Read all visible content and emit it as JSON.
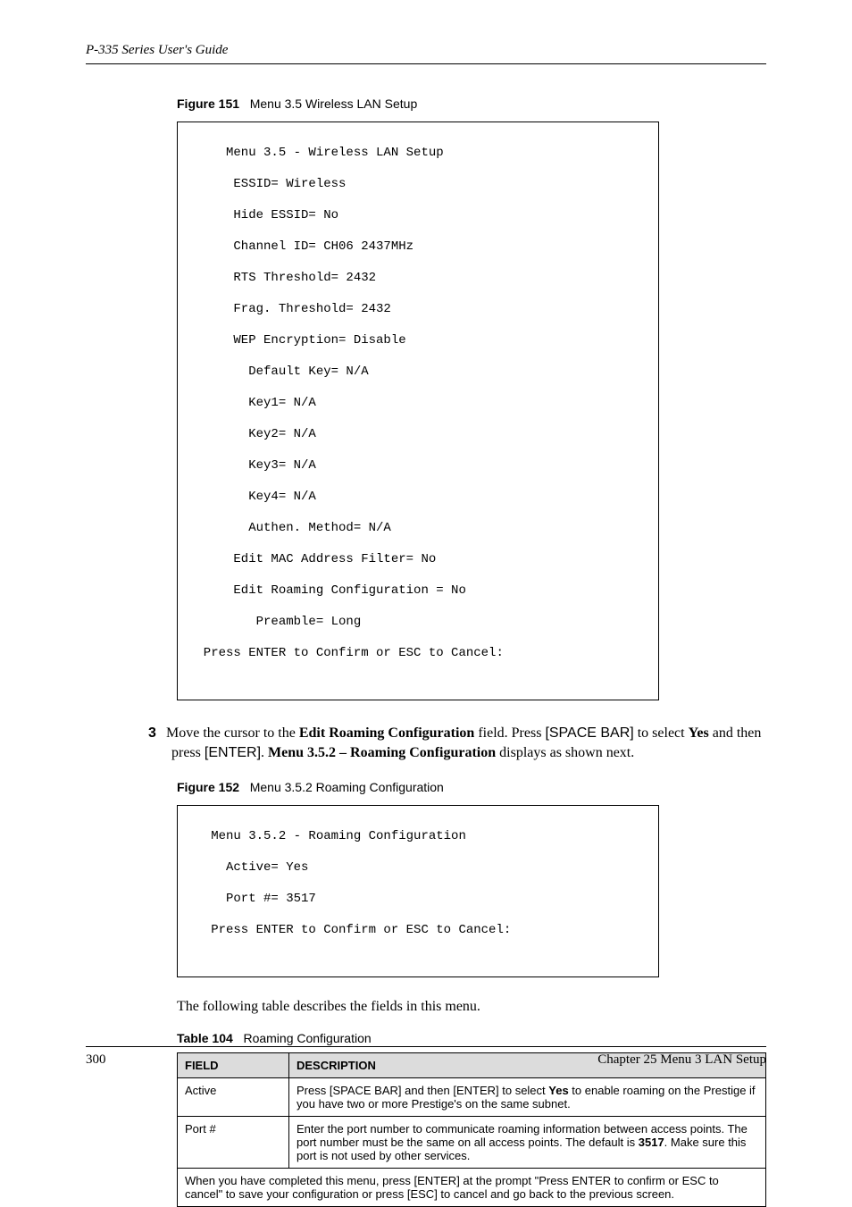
{
  "header": {
    "guide_title": "P-335 Series User's Guide"
  },
  "figure151": {
    "label": "Figure 151",
    "title": "Menu 3.5 Wireless LAN Setup",
    "lines": [
      "     Menu 3.5 - Wireless LAN Setup",
      "      ESSID= Wireless",
      "      Hide ESSID= No",
      "      Channel ID= CH06 2437MHz",
      "      RTS Threshold= 2432",
      "      Frag. Threshold= 2432",
      "      WEP Encryption= Disable",
      "        Default Key= N/A",
      "        Key1= N/A",
      "        Key2= N/A",
      "        Key3= N/A",
      "        Key4= N/A",
      "        Authen. Method= N/A",
      "      Edit MAC Address Filter= No",
      "      Edit Roaming Configuration = No",
      "         Preamble= Long",
      "  Press ENTER to Confirm or ESC to Cancel:"
    ]
  },
  "step3": {
    "number": "3",
    "t1": "Move the cursor to the ",
    "t2": "Edit Roaming Configuration",
    "t3": " field. Press ",
    "t4": "[SPACE BAR]",
    "t5": " to select ",
    "t6": "Yes",
    "t7": " and then press ",
    "t8": "[ENTER]",
    "t9": ". ",
    "t10": "Menu 3.5.2 – Roaming Configuration",
    "t11": " displays as shown next."
  },
  "figure152": {
    "label": "Figure 152",
    "title": "Menu 3.5.2 Roaming Configuration",
    "lines": [
      "   Menu 3.5.2 - Roaming Configuration",
      "     Active= Yes",
      "     Port #= 3517",
      "   Press ENTER to Confirm or ESC to Cancel:"
    ]
  },
  "para_intro": "The following table describes the fields in this menu.",
  "table104": {
    "label": "Table 104",
    "title": "Roaming Configuration",
    "head_field": "FIELD",
    "head_desc": "DESCRIPTION",
    "rows": [
      {
        "field": "Active",
        "d0": "Press [SPACE BAR] and then [ENTER] to select ",
        "d1_bold": "Yes",
        "d2": " to enable roaming on the Prestige if you have two or more Prestige's on the same subnet."
      },
      {
        "field": "Port #",
        "d0": "Enter the port number to communicate roaming information between access points. The port number must be the same on all access points. The default is ",
        "d1_bold": "3517",
        "d2": ". Make sure this port is not used by other services."
      }
    ],
    "footer_note": "When you have completed this menu, press [ENTER] at the prompt \"Press ENTER to confirm or ESC to cancel\" to save your configuration or press [ESC] to cancel and go back to the previous screen."
  },
  "footer": {
    "page_number": "300",
    "chapter": "Chapter 25 Menu 3 LAN Setup"
  }
}
